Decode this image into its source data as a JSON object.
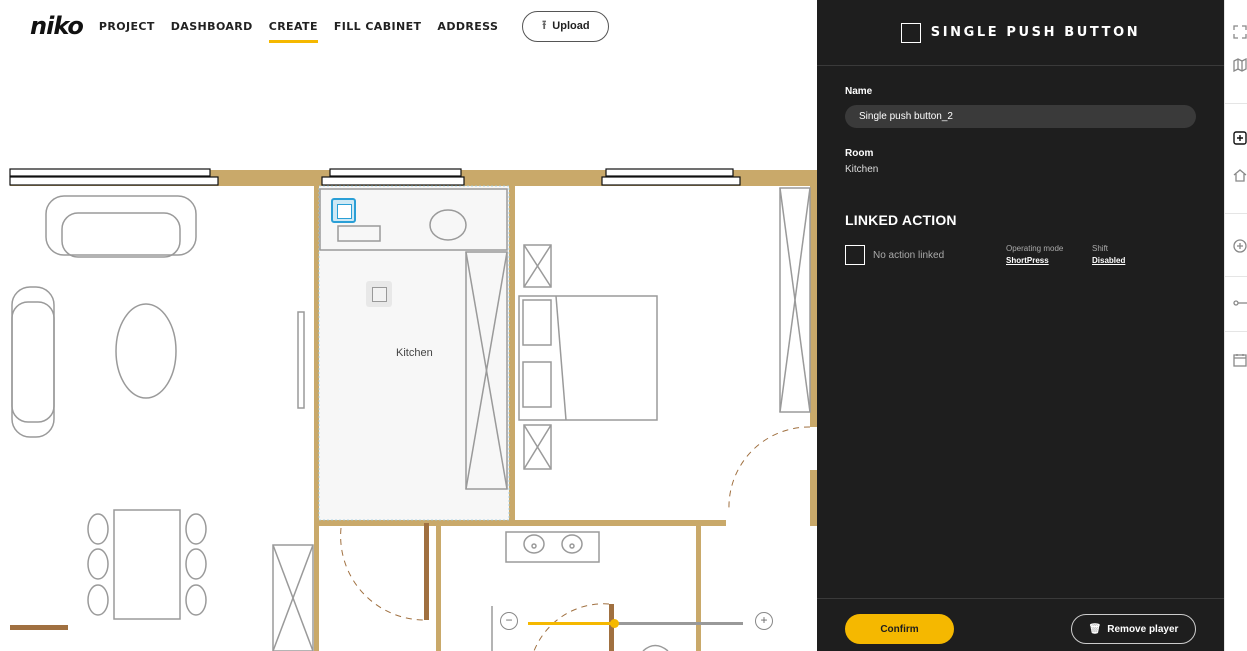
{
  "nav": {
    "logo": "niko",
    "items": [
      {
        "label": "PROJECT"
      },
      {
        "label": "DASHBOARD"
      },
      {
        "label": "CREATE"
      },
      {
        "label": "FILL CABINET"
      },
      {
        "label": "ADDRESS"
      }
    ],
    "active": "CREATE",
    "upload_label": "Upload",
    "upload_icon": "upload-arrow-icon"
  },
  "floorplan": {
    "room_label": "Kitchen",
    "zoom_level": 0.4
  },
  "panel": {
    "title": "SINGLE PUSH BUTTON",
    "name_label": "Name",
    "name_value": "Single push button_2",
    "room_label": "Room",
    "room_value": "Kitchen",
    "linked_action_title": "LINKED ACTION",
    "no_action_text": "No action linked",
    "operating_mode_label": "Operating mode",
    "operating_mode_value": "ShortPress",
    "shift_label": "Shift",
    "shift_value": "Disabled",
    "confirm_label": "Confirm",
    "remove_label": "Remove player"
  },
  "toolbar": {
    "icons": [
      "fullscreen-icon",
      "map-icon",
      "add-device-icon",
      "home-icon",
      "add-circle-icon",
      "connection-icon",
      "calendar-icon"
    ]
  },
  "colors": {
    "accent": "#f5b800",
    "panel_bg": "#1e1e1e",
    "wall": "#c9a96a",
    "selection": "#2a9fd6"
  }
}
